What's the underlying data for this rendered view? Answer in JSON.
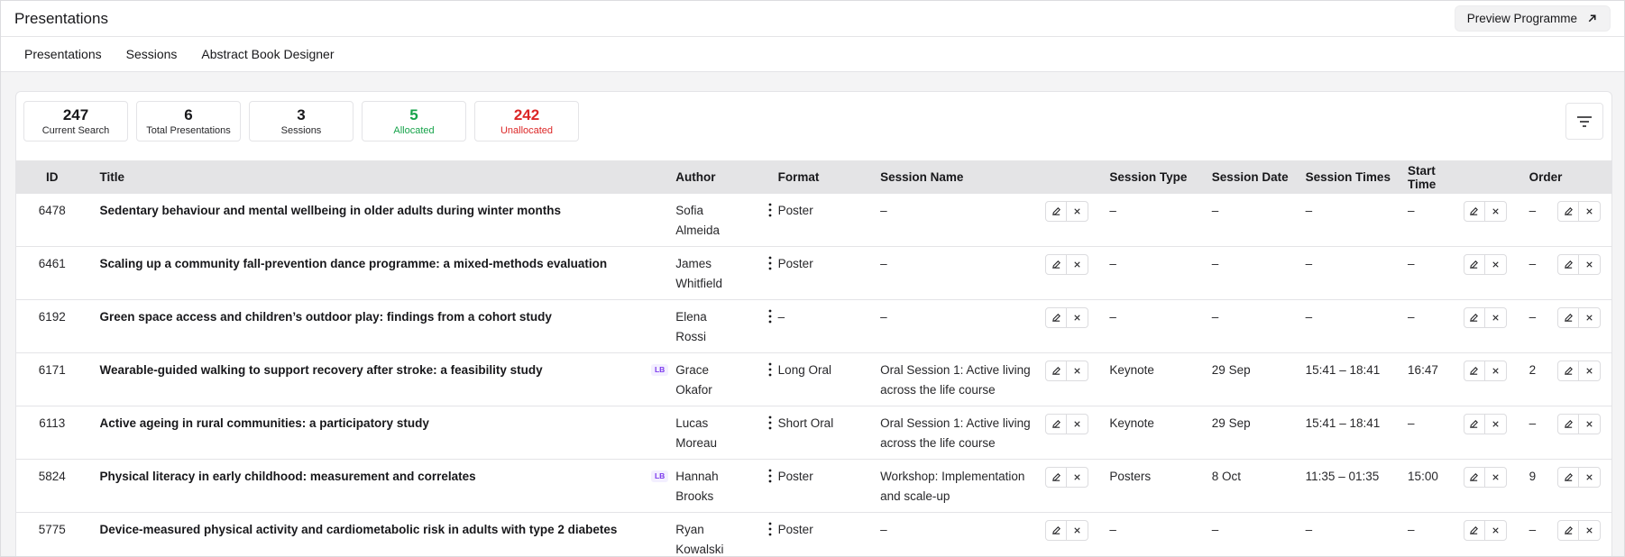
{
  "header": {
    "title": "Presentations",
    "preview_label": "Preview Programme"
  },
  "tabs": [
    "Presentations",
    "Sessions",
    "Abstract Book Designer"
  ],
  "stats": [
    {
      "value": "247",
      "label": "Current Search",
      "tone": "default"
    },
    {
      "value": "6",
      "label": "Total Presentations",
      "tone": "default"
    },
    {
      "value": "3",
      "label": "Sessions",
      "tone": "default"
    },
    {
      "value": "5",
      "label": "Allocated",
      "tone": "green"
    },
    {
      "value": "242",
      "label": "Unallocated",
      "tone": "red"
    }
  ],
  "colors": {
    "allocated": "#16a34a",
    "unallocated": "#dc2626",
    "lb_badge": "#7c3aed"
  },
  "columns": {
    "id": "ID",
    "title": "Title",
    "author": "Author",
    "format": "Format",
    "session_name": "Session Name",
    "session_type": "Session Type",
    "session_date": "Session Date",
    "session_times": "Session Times",
    "start_time": "Start Time",
    "order": "Order"
  },
  "rows": [
    {
      "id": "6478",
      "title": "Sedentary behaviour and mental wellbeing in older adults during winter months",
      "lb": "",
      "author": "Sofia Almeida",
      "format": "Poster",
      "session_name": "–",
      "session_type": "–",
      "session_date": "–",
      "session_times": "–",
      "start_time": "–",
      "order": "–"
    },
    {
      "id": "6461",
      "title": "Scaling up a community fall-prevention dance programme: a mixed-methods evaluation",
      "lb": "",
      "author": "James Whitfield",
      "format": "Poster",
      "session_name": "–",
      "session_type": "–",
      "session_date": "–",
      "session_times": "–",
      "start_time": "–",
      "order": "–"
    },
    {
      "id": "6192",
      "title": "Green space access and children’s outdoor play: findings from a cohort study",
      "lb": "",
      "author": "Elena Rossi",
      "format": "–",
      "session_name": "–",
      "session_type": "–",
      "session_date": "–",
      "session_times": "–",
      "start_time": "–",
      "order": "–"
    },
    {
      "id": "6171",
      "title": "Wearable-guided walking to support recovery after stroke: a feasibility study",
      "lb": "LB",
      "author": "Grace Okafor",
      "format": "Long Oral",
      "session_name": "Oral Session 1: Active living across the life course",
      "session_type": "Keynote",
      "session_date": "29 Sep",
      "session_times": "15:41 – 18:41",
      "start_time": "16:47",
      "order": "2"
    },
    {
      "id": "6113",
      "title": "Active ageing in rural communities: a participatory study",
      "lb": "",
      "author": "Lucas Moreau",
      "format": "Short Oral",
      "session_name": "Oral Session 1: Active living across the life course",
      "session_type": "Keynote",
      "session_date": "29 Sep",
      "session_times": "15:41 – 18:41",
      "start_time": "–",
      "order": "–"
    },
    {
      "id": "5824",
      "title": "Physical literacy in early childhood: measurement and correlates",
      "lb": "LB",
      "author": "Hannah Brooks",
      "format": "Poster",
      "session_name": "Workshop: Implementation and scale-up",
      "session_type": "Posters",
      "session_date": "8 Oct",
      "session_times": "11:35 – 01:35",
      "start_time": "15:00",
      "order": "9"
    },
    {
      "id": "5775",
      "title": "Device-measured physical activity and cardiometabolic risk in adults with type 2 diabetes",
      "lb": "",
      "author": "Ryan Kowalski",
      "format": "Poster",
      "session_name": "–",
      "session_type": "–",
      "session_date": "–",
      "session_times": "–",
      "start_time": "–",
      "order": "–"
    }
  ]
}
